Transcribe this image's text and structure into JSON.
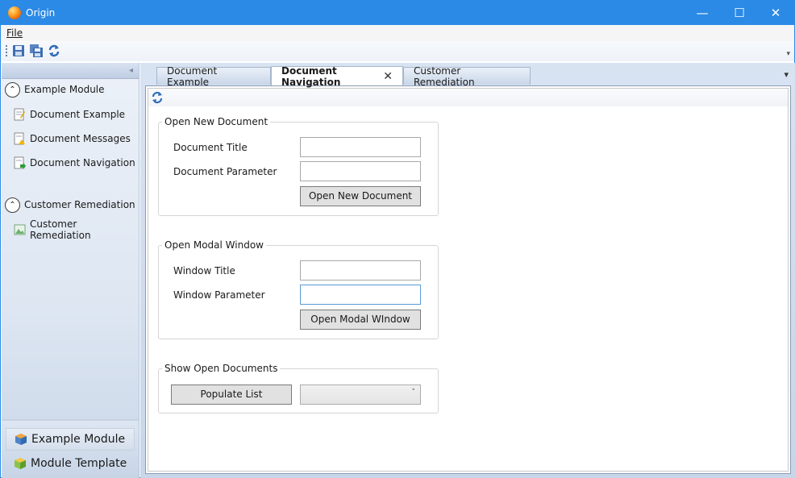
{
  "window": {
    "title": "Origin",
    "minimize_glyph": "—",
    "maximize_glyph": "☐",
    "close_glyph": "✕"
  },
  "menu": {
    "file_label": "File"
  },
  "toolbar": {
    "icons": [
      "save-icon",
      "save-all-icon",
      "refresh-icon"
    ],
    "overflow_glyph": "▾"
  },
  "sidebar": {
    "collapse_glyph": "◂",
    "groups": [
      {
        "label": "Example Module",
        "items": [
          {
            "label": "Document Example",
            "icon": "document-edit-icon"
          },
          {
            "label": "Document Messages",
            "icon": "document-warning-icon"
          },
          {
            "label": "Document Navigation",
            "icon": "document-navigate-icon"
          }
        ]
      },
      {
        "label": "Customer Remediation",
        "items": [
          {
            "label": "Customer Remediation",
            "icon": "image-document-icon"
          }
        ]
      }
    ],
    "modules": [
      {
        "label": "Example Module",
        "icon": "cube-blue-icon",
        "selected": true
      },
      {
        "label": "Module Template",
        "icon": "cube-green-icon",
        "selected": false
      }
    ]
  },
  "tabs": [
    {
      "label": "Document Example",
      "active": false
    },
    {
      "label": "Document Navigation",
      "active": true,
      "close_glyph": "✕"
    },
    {
      "label": "Customer Remediation",
      "active": false
    }
  ],
  "tab_overflow_glyph": "▾",
  "open_new_document": {
    "legend": "Open New Document",
    "title_label": "Document Title",
    "title_value": "",
    "parameter_label": "Document Parameter",
    "parameter_value": "",
    "button_label": "Open New Document"
  },
  "open_modal_window": {
    "legend": "Open Modal Window",
    "title_label": "Window Title",
    "title_value": "",
    "parameter_label": "Window Parameter",
    "parameter_value": "",
    "button_label": "Open Modal WIndow"
  },
  "show_open_documents": {
    "legend": "Show Open Documents",
    "button_label": "Populate List",
    "selected_value": "",
    "dropdown_glyph": "˅"
  },
  "colors": {
    "titlebar": "#2b8ae6",
    "sidebar": "#dde6f2",
    "button": "#e1e1e1"
  }
}
